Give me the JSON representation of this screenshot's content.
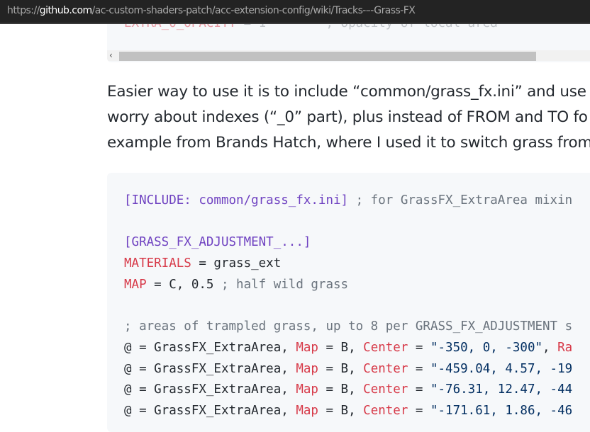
{
  "browser": {
    "url_scheme": "https://",
    "url_host": "github.com",
    "url_path": "/ac-custom-shaders-patch/acc-extension-config/wiki/Tracks-–-Grass-FX"
  },
  "code_top": {
    "cut_key": "EXTRA_0_OPACITY",
    "cut_rest": " = 1        ; Opacity of local area",
    "scroll_left_icon": "chevron-left-icon",
    "scroll_left_glyph": "‹"
  },
  "paragraph": {
    "lines": [
      "Easier way to use it is to include “common/grass_fx.ini” and use",
      "worry about indexes (“_0” part), plus instead of FROM and TO fo",
      "example from Brands Hatch, where I used it to switch grass from"
    ]
  },
  "code_block": {
    "lines": [
      [
        {
          "t": "[INCLUDE: common/grass_fx.ini]",
          "c": "section"
        },
        {
          "t": " ; for GrassFX_ExtraArea mixin",
          "c": "comment"
        }
      ],
      [],
      [
        {
          "t": "[GRASS_FX_ADJUSTMENT_...]",
          "c": "section"
        }
      ],
      [
        {
          "t": "MATERIALS",
          "c": "key"
        },
        {
          "t": " = grass_ext",
          "c": "plain"
        }
      ],
      [
        {
          "t": "MAP",
          "c": "key"
        },
        {
          "t": " = C, 0.5 ",
          "c": "plain"
        },
        {
          "t": "; half wild grass",
          "c": "comment"
        }
      ],
      [],
      [
        {
          "t": "; areas of trampled grass, up to 8 per GRASS_FX_ADJUSTMENT s",
          "c": "comment"
        }
      ],
      [
        {
          "t": "@ = GrassFX_ExtraArea, ",
          "c": "plain"
        },
        {
          "t": "Map",
          "c": "key"
        },
        {
          "t": " = B, ",
          "c": "plain"
        },
        {
          "t": "Center",
          "c": "key"
        },
        {
          "t": " = ",
          "c": "plain"
        },
        {
          "t": "\"-350, 0, -300\"",
          "c": "string"
        },
        {
          "t": ", ",
          "c": "plain"
        },
        {
          "t": "Ra",
          "c": "key"
        }
      ],
      [
        {
          "t": "@ = GrassFX_ExtraArea, ",
          "c": "plain"
        },
        {
          "t": "Map",
          "c": "key"
        },
        {
          "t": " = B, ",
          "c": "plain"
        },
        {
          "t": "Center",
          "c": "key"
        },
        {
          "t": " = ",
          "c": "plain"
        },
        {
          "t": "\"-459.04, 4.57, -19",
          "c": "string"
        }
      ],
      [
        {
          "t": "@ = GrassFX_ExtraArea, ",
          "c": "plain"
        },
        {
          "t": "Map",
          "c": "key"
        },
        {
          "t": " = B, ",
          "c": "plain"
        },
        {
          "t": "Center",
          "c": "key"
        },
        {
          "t": " = ",
          "c": "plain"
        },
        {
          "t": "\"-76.31, 12.47, -44",
          "c": "string"
        }
      ],
      [
        {
          "t": "@ = GrassFX_ExtraArea, ",
          "c": "plain"
        },
        {
          "t": "Map",
          "c": "key"
        },
        {
          "t": " = B, ",
          "c": "plain"
        },
        {
          "t": "Center",
          "c": "key"
        },
        {
          "t": " = ",
          "c": "plain"
        },
        {
          "t": "\"-171.61, 1.86, -46",
          "c": "string"
        }
      ]
    ]
  }
}
